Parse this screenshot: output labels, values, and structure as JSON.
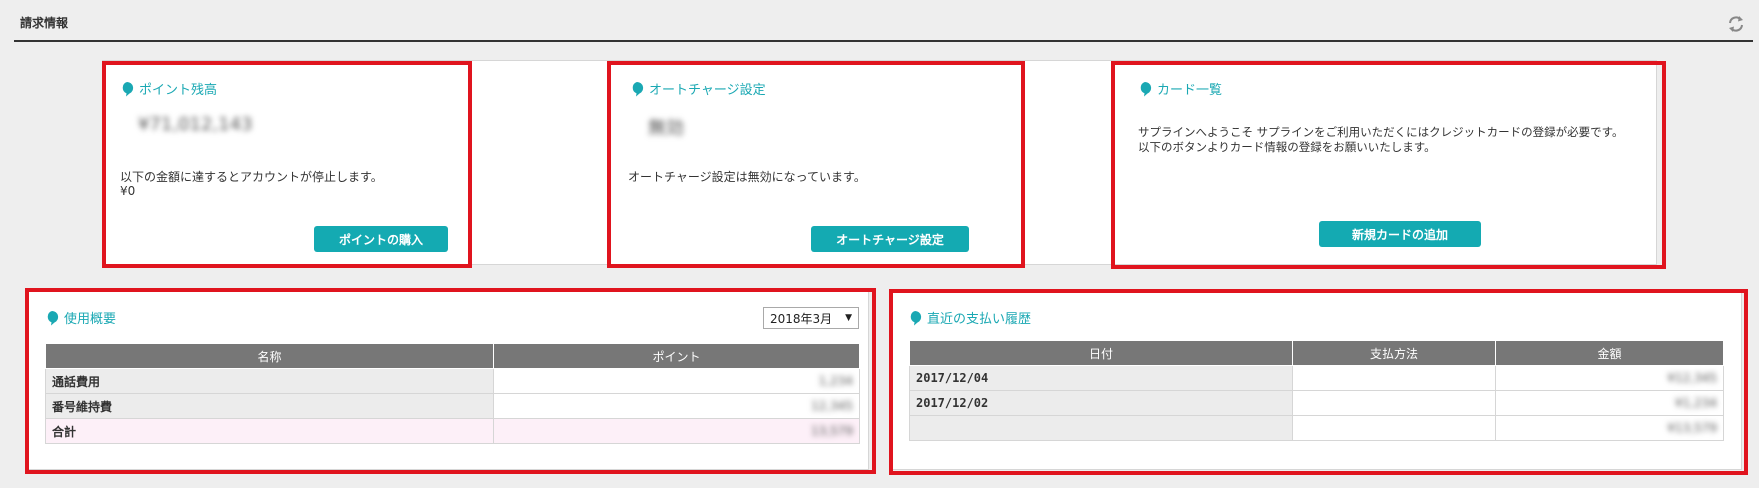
{
  "page": {
    "title": "請求情報"
  },
  "point_balance": {
    "title": "ポイント残高",
    "value": "¥71,012,143",
    "note": "以下の金額に達するとアカウントが停止します。",
    "threshold": "¥0",
    "button_label": "ポイントの購入"
  },
  "auto_charge": {
    "title": "オートチャージ設定",
    "value": "無効",
    "note": "オートチャージ設定は無効になっています。",
    "button_label": "オートチャージ設定"
  },
  "card_list": {
    "title": "カード一覧",
    "message_line1": "サプラインへようこそ サプラインをご利用いただくにはクレジットカードの登録が必要です。",
    "message_line2": "以下のボタンよりカード情報の登録をお願いいたします。",
    "button_label": "新規カードの追加"
  },
  "usage": {
    "title": "使用概要",
    "month_selected": "2018年3月",
    "columns": [
      "名称",
      "ポイント"
    ],
    "rows": [
      {
        "name": "通話費用",
        "points": "1,234"
      },
      {
        "name": "番号維持費",
        "points": "12,345"
      },
      {
        "name": "合計",
        "points": "13,579"
      }
    ]
  },
  "payments": {
    "title": "直近の支払い履歴",
    "columns": [
      "日付",
      "支払方法",
      "金額"
    ],
    "rows": [
      {
        "date": "2017/12/04",
        "method": "",
        "amount": "¥12,345"
      },
      {
        "date": "2017/12/02",
        "method": "",
        "amount": "¥1,234"
      },
      {
        "date": "",
        "method": "",
        "amount": "¥13,579"
      }
    ]
  },
  "colors": {
    "accent": "#14aab2",
    "highlight_frame": "#e0141e",
    "header_gray": "#777777",
    "total_row": "#fdf0f8"
  }
}
